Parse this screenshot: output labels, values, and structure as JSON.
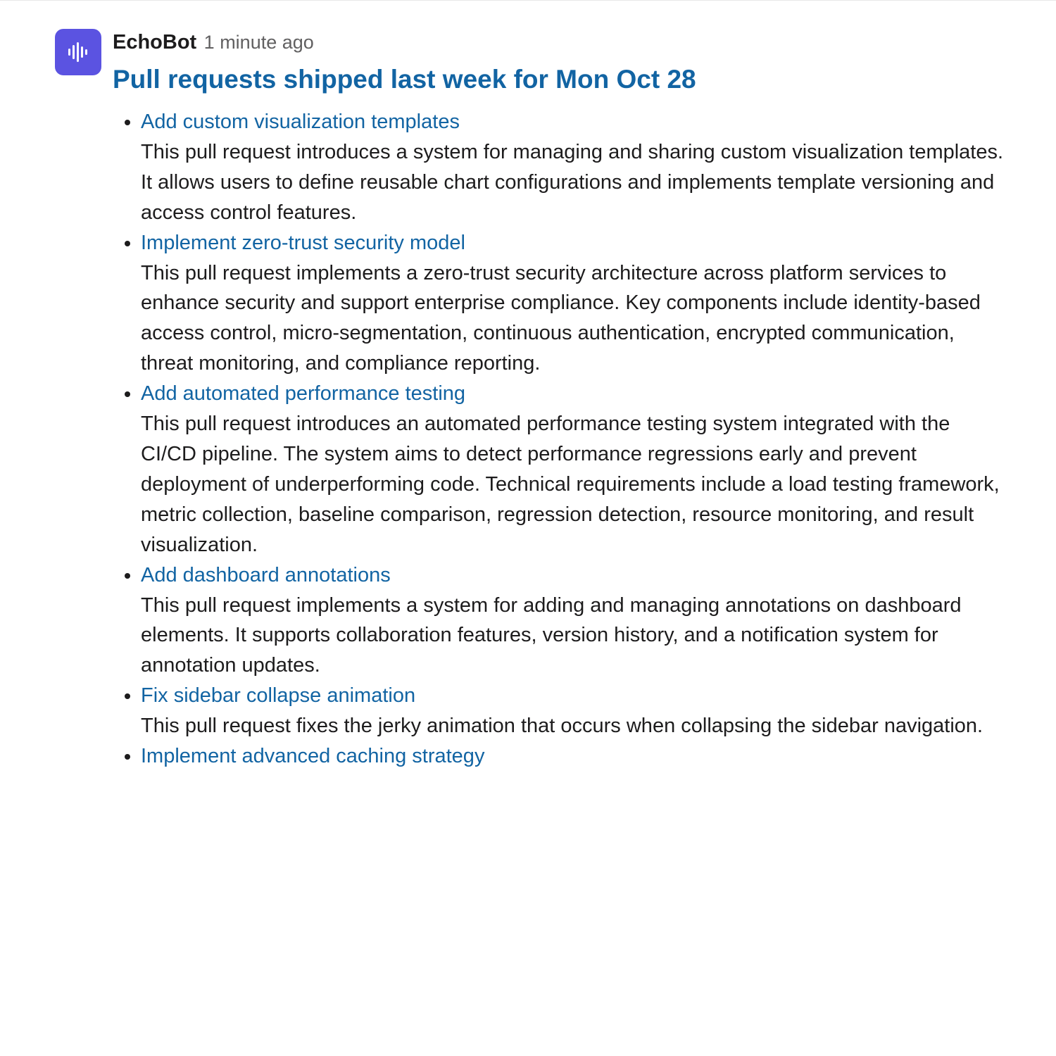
{
  "message": {
    "bot_name": "EchoBot",
    "timestamp": "1 minute ago",
    "title": "Pull requests shipped last week for Mon Oct 28"
  },
  "pull_requests": [
    {
      "title": "Add custom visualization templates",
      "description": "This pull request introduces a system for managing and sharing custom visualization templates. It allows users to define reusable chart configurations and implements template versioning and access control features."
    },
    {
      "title": "Implement zero-trust security model",
      "description": "This pull request implements a zero-trust security architecture across platform services to enhance security and support enterprise compliance. Key components include identity-based access control, micro-segmentation, continuous authentication, encrypted communication, threat monitoring, and compliance reporting."
    },
    {
      "title": "Add automated performance testing",
      "description": "This pull request introduces an automated performance testing system integrated with the CI/CD pipeline. The system aims to detect performance regressions early and prevent deployment of underperforming code. Technical requirements include a load testing framework, metric collection, baseline comparison, regression detection, resource monitoring, and result visualization."
    },
    {
      "title": "Add dashboard annotations",
      "description": "This pull request implements a system for adding and managing annotations on dashboard elements. It supports collaboration features, version history, and a notification system for annotation updates."
    },
    {
      "title": "Fix sidebar collapse animation",
      "description": "This pull request fixes the jerky animation that occurs when collapsing the sidebar navigation."
    },
    {
      "title": "Implement advanced caching strategy",
      "description": ""
    }
  ]
}
